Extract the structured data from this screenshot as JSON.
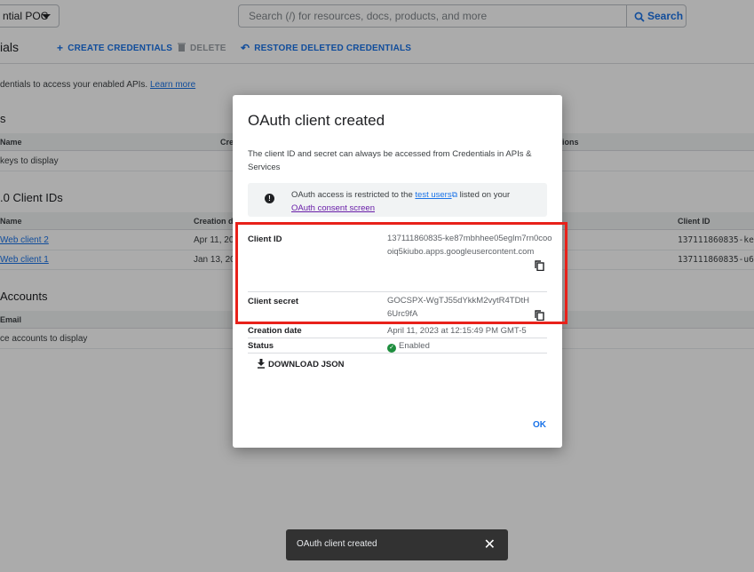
{
  "header": {
    "project_label": "ntial POC",
    "search_placeholder": "Search (/) for resources, docs, products, and more",
    "search_button": "Search"
  },
  "actionbar": {
    "page_title": "ials",
    "create_credentials": "CREATE CREDENTIALS",
    "delete": "DELETE",
    "restore": "RESTORE DELETED CREDENTIALS"
  },
  "intro": {
    "text": "dentials to access your enabled APIs.",
    "learn_more": "Learn more"
  },
  "api_keys": {
    "title": "s",
    "col_name": "Name",
    "col_created": "Cre",
    "col_restrictions": "tions",
    "empty": "keys to display"
  },
  "oauth_clients": {
    "title": ".0 Client IDs",
    "col_name": "Name",
    "col_created": "Creation da",
    "col_client_id": "Client ID",
    "rows": [
      {
        "name": "Web client 2",
        "date": "Apr 11, 20",
        "client_id": "137111860835-ke"
      },
      {
        "name": "Web client 1",
        "date": "Jan 13, 20",
        "client_id": "137111860835-u6"
      }
    ]
  },
  "service_accounts": {
    "title": "Accounts",
    "col_email": "Email",
    "empty": "ce accounts to display"
  },
  "dialog": {
    "title": "OAuth client created",
    "description": "The client ID and secret can always be accessed from Credentials in APIs & Services",
    "notice_prefix": "OAuth access is restricted to the",
    "notice_link_test_users": "test users",
    "notice_mid": "listed on your",
    "notice_link_consent": "OAuth consent screen",
    "client_id_label": "Client ID",
    "client_id_value": "137111860835-ke87mbhhee05eglm7rn0coooiq5kiubo.apps.googleusercontent.com",
    "client_secret_label": "Client secret",
    "client_secret_value": "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",
    "creation_date_label": "Creation date",
    "creation_date_value": "April 11, 2023 at 12:15:49 PM GMT-5",
    "status_label": "Status",
    "status_value": "Enabled",
    "download_json": "DOWNLOAD JSON",
    "ok": "OK"
  },
  "snackbar": {
    "message": "OAuth client created"
  },
  "colors": {
    "accent": "#1a73e8",
    "highlight": "#e8211a",
    "status_ok": "#1e8e3e"
  }
}
